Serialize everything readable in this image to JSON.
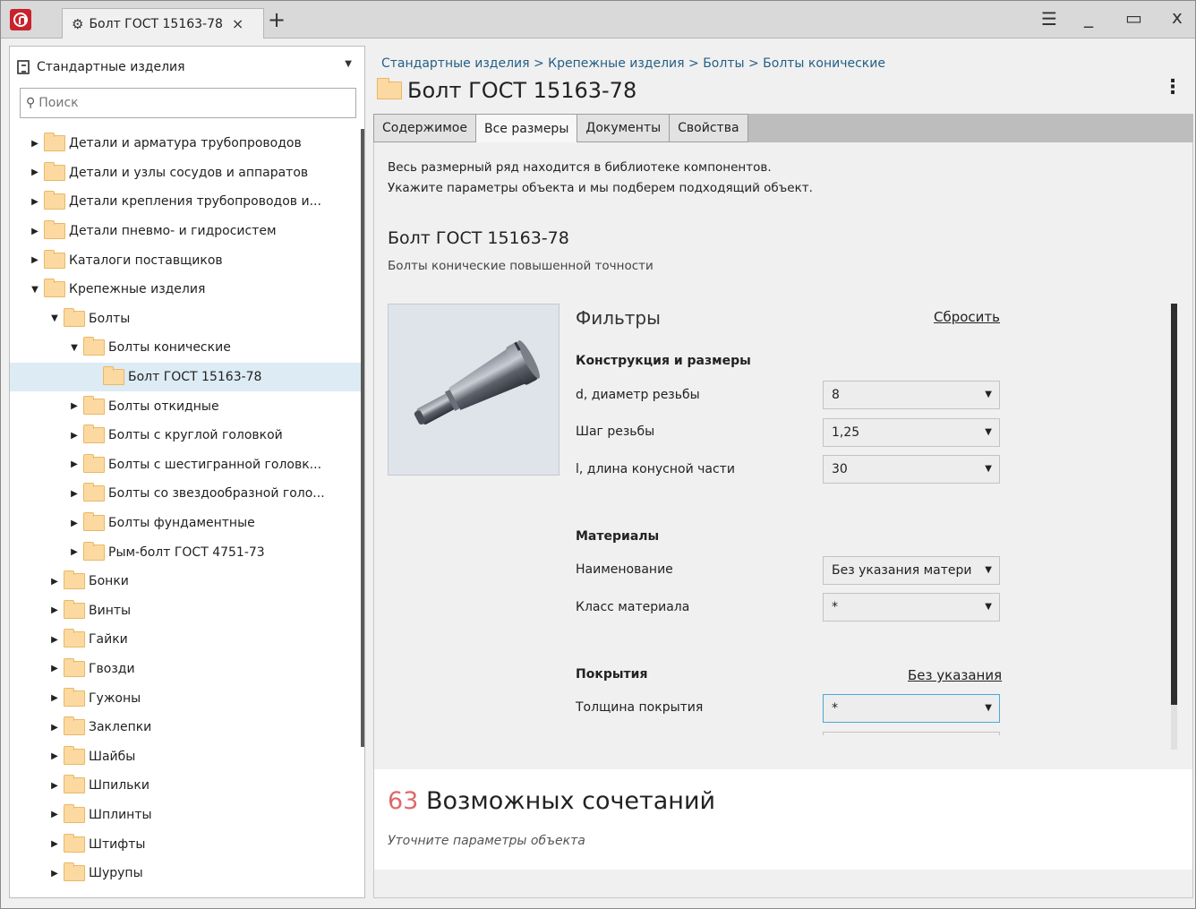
{
  "titlebar": {
    "tab_title": "Болт ГОСТ 15163-78",
    "tab_close": "×",
    "new_tab": "+",
    "menu_icon": "☰",
    "minimize_icon": "_",
    "maximize_icon": "▭",
    "close_icon": "x"
  },
  "sidebar": {
    "library": "Стандартные изделия",
    "search_placeholder": "Поиск",
    "tree": [
      {
        "label": "Детали и арматура трубопроводов",
        "level": 0,
        "state": "collapsed"
      },
      {
        "label": "Детали и узлы сосудов и аппаратов",
        "level": 0,
        "state": "collapsed"
      },
      {
        "label": "Детали крепления трубопроводов и...",
        "level": 0,
        "state": "collapsed"
      },
      {
        "label": "Детали пневмо- и гидросистем",
        "level": 0,
        "state": "collapsed"
      },
      {
        "label": "Каталоги поставщиков",
        "level": 0,
        "state": "collapsed"
      },
      {
        "label": "Крепежные изделия",
        "level": 0,
        "state": "expanded"
      },
      {
        "label": "Болты",
        "level": 1,
        "state": "expanded"
      },
      {
        "label": "Болты конические",
        "level": 2,
        "state": "expanded"
      },
      {
        "label": "Болт ГОСТ 15163-78",
        "level": 3,
        "state": "leaf",
        "selected": true
      },
      {
        "label": "Болты откидные",
        "level": 2,
        "state": "collapsed"
      },
      {
        "label": "Болты с круглой головкой",
        "level": 2,
        "state": "collapsed"
      },
      {
        "label": "Болты с шестигранной головк...",
        "level": 2,
        "state": "collapsed"
      },
      {
        "label": "Болты со звездообразной голо...",
        "level": 2,
        "state": "collapsed"
      },
      {
        "label": "Болты фундаментные",
        "level": 2,
        "state": "collapsed"
      },
      {
        "label": "Рым-болт ГОСТ 4751-73",
        "level": 2,
        "state": "collapsed"
      },
      {
        "label": "Бонки",
        "level": 1,
        "state": "collapsed"
      },
      {
        "label": "Винты",
        "level": 1,
        "state": "collapsed"
      },
      {
        "label": "Гайки",
        "level": 1,
        "state": "collapsed"
      },
      {
        "label": "Гвозди",
        "level": 1,
        "state": "collapsed"
      },
      {
        "label": "Гужоны",
        "level": 1,
        "state": "collapsed"
      },
      {
        "label": "Заклепки",
        "level": 1,
        "state": "collapsed"
      },
      {
        "label": "Шайбы",
        "level": 1,
        "state": "collapsed"
      },
      {
        "label": "Шпильки",
        "level": 1,
        "state": "collapsed"
      },
      {
        "label": "Шплинты",
        "level": 1,
        "state": "collapsed"
      },
      {
        "label": "Штифты",
        "level": 1,
        "state": "collapsed"
      },
      {
        "label": "Шурупы",
        "level": 1,
        "state": "collapsed"
      }
    ]
  },
  "main": {
    "breadcrumb": "Стандартные изделия > Крепежные изделия > Болты > Болты конические",
    "title": "Болт ГОСТ 15163-78",
    "more_icon": "⋮",
    "tabs": [
      {
        "label": "Содержимое",
        "active": false
      },
      {
        "label": "Все размеры",
        "active": true
      },
      {
        "label": "Документы",
        "active": false
      },
      {
        "label": "Свойства",
        "active": false
      }
    ],
    "intro_line1": "Весь размерный ряд находится в библиотеке компонентов.",
    "intro_line2": "Укажите параметры объекта и мы подберем подходящий объект.",
    "product_name": "Болт ГОСТ 15163-78",
    "product_description": "Болты конические повышенной точности",
    "filters": {
      "title": "Фильтры",
      "reset": "Сбросить",
      "design_title": "Конструкция и размеры",
      "d_label": "d, диаметр резьбы",
      "d_value": "8",
      "pitch_label": "Шаг резьбы",
      "pitch_value": "1,25",
      "length_label": "l, длина конусной части",
      "length_value": "30",
      "materials_title": "Материалы",
      "material_name_label": "Наименование",
      "material_name_value": "Без указания матери",
      "material_class_label": "Класс материала",
      "material_class_value": "*",
      "coverage_title": "Покрытия",
      "coverage_link": "Без указания",
      "coverage_thickness_label": "Толщина покрытия",
      "coverage_thickness_value": "*"
    },
    "results": {
      "count": "63",
      "text": "Возможных сочетаний",
      "hint": "Уточните параметры объекта"
    }
  },
  "colors": {
    "accent_link": "#245f86",
    "count": "#e0676b",
    "selected_row": "#dcebf4",
    "folder": "#fcd9a0"
  }
}
